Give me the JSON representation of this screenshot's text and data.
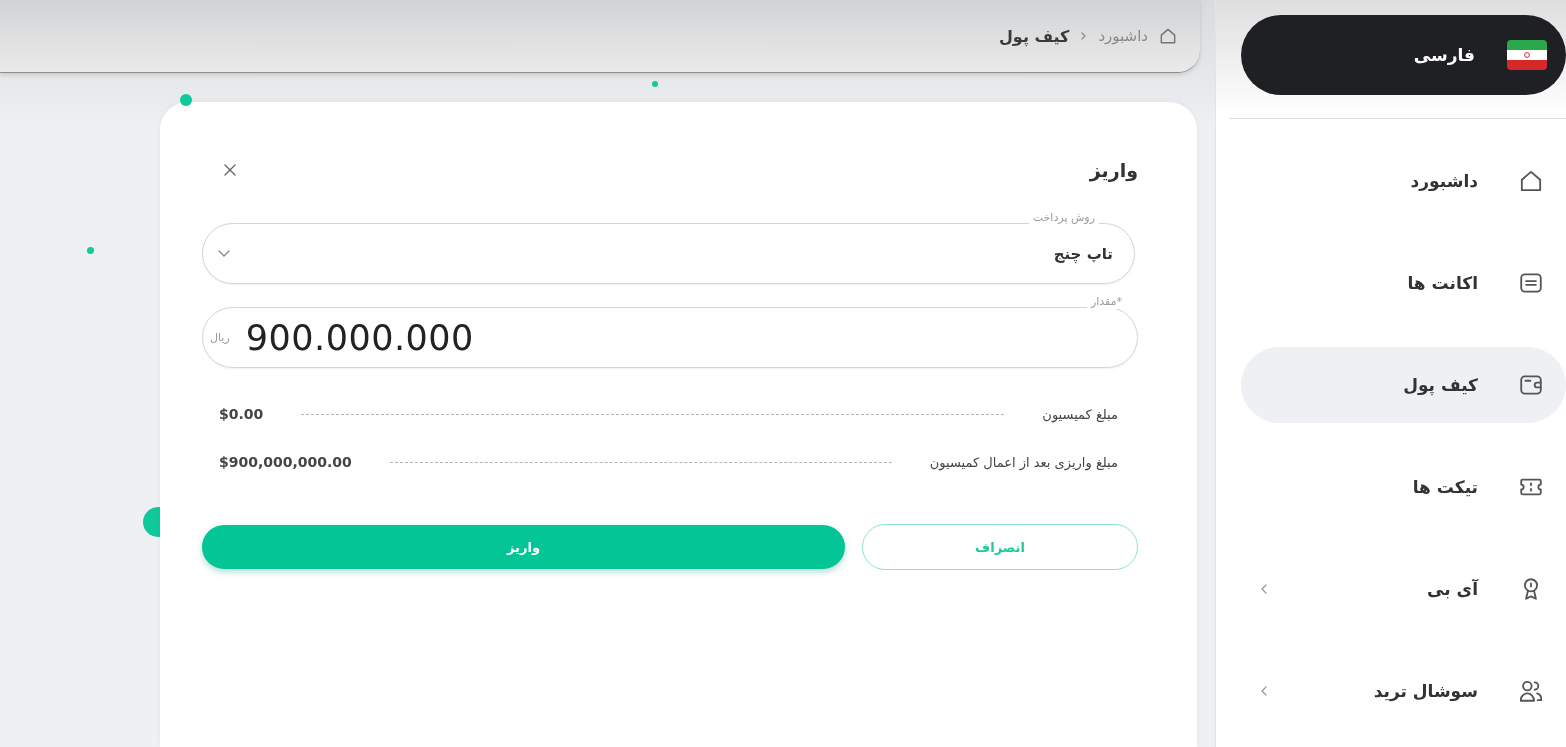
{
  "language": {
    "label": "فارسی"
  },
  "sidebar": {
    "items": [
      {
        "label": "داشبورد",
        "selected": false,
        "has_submenu": false
      },
      {
        "label": "اکانت ها",
        "selected": false,
        "has_submenu": false
      },
      {
        "label": "کیف پول",
        "selected": true,
        "has_submenu": false
      },
      {
        "label": "تیکت ها",
        "selected": false,
        "has_submenu": false
      },
      {
        "label": "آی بی",
        "selected": false,
        "has_submenu": true
      },
      {
        "label": "سوشال ترید",
        "selected": false,
        "has_submenu": true
      }
    ]
  },
  "breadcrumb": [
    {
      "label": "داشبورد",
      "current": false
    },
    {
      "label": "کیف پول",
      "current": true
    }
  ],
  "modal": {
    "title": "واریز",
    "fields": [
      {
        "kind": "select",
        "label": "روش پرداخت",
        "value": "تاپ چنج"
      },
      {
        "kind": "amount",
        "label": "*مقدار",
        "value": "900.000.000",
        "unit": "ریال"
      }
    ],
    "summary": [
      {
        "label": "مبلغ کمیسیون",
        "value": "$0.00"
      },
      {
        "label": "مبلغ واریزی بعد از اعمال کمیسیون",
        "value": "$900,000,000.00"
      }
    ],
    "buttons": [
      {
        "kind": "secondary",
        "label": "انصراف"
      },
      {
        "kind": "primary",
        "label": "واریز"
      }
    ]
  }
}
